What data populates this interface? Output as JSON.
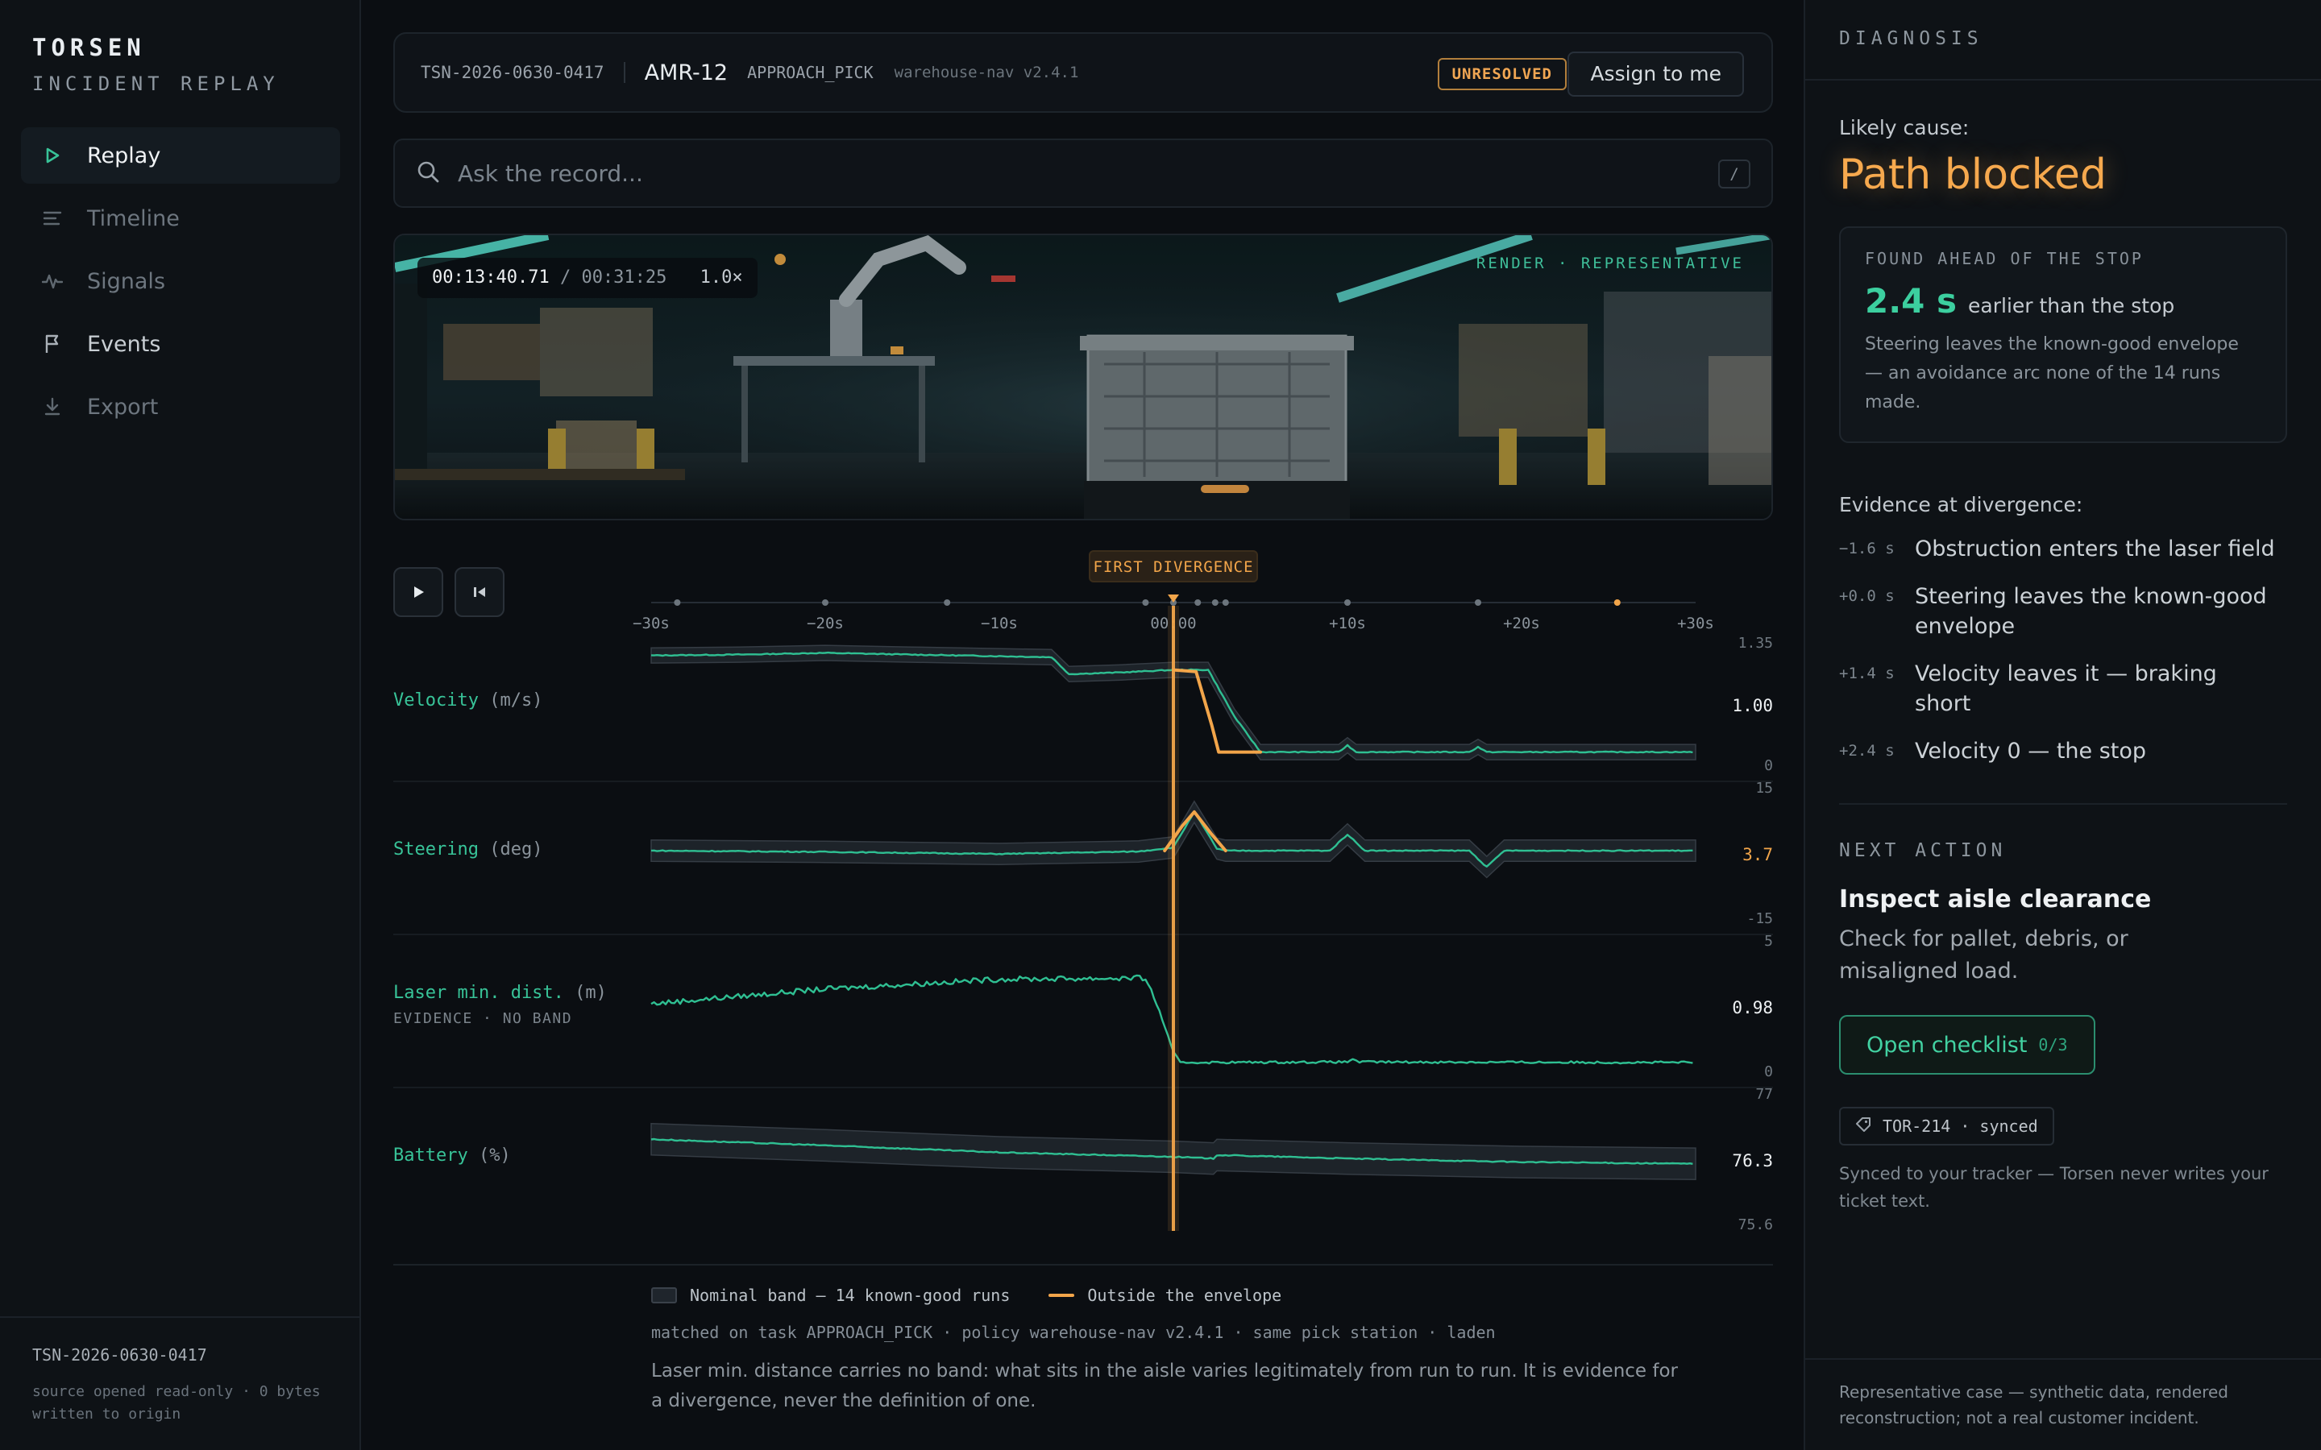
{
  "brand": {
    "name": "TORSEN",
    "subtitle": "INCIDENT REPLAY"
  },
  "nav": [
    {
      "label": "Replay",
      "icon": "play-icon",
      "active": true
    },
    {
      "label": "Timeline",
      "icon": "timeline-icon",
      "active": false
    },
    {
      "label": "Signals",
      "icon": "pulse-icon",
      "active": false
    },
    {
      "label": "Events",
      "icon": "flag-icon",
      "active": false
    },
    {
      "label": "Export",
      "icon": "download-icon",
      "active": false
    }
  ],
  "sidebar_footer": {
    "incident_id": "TSN-2026-0630-0417",
    "note": "source opened read-only · 0 bytes written to origin"
  },
  "header": {
    "incident_id": "TSN-2026-0630-0417",
    "robot": "AMR-12",
    "task": "APPROACH_PICK",
    "version": "warehouse-nav v2.4.1",
    "status": "UNRESOLVED",
    "assign_label": "Assign to me"
  },
  "ask": {
    "placeholder": "Ask the record...",
    "shortcut": "/"
  },
  "video": {
    "current_time": "00:13:40.71",
    "total_time": "/ 00:31:25",
    "speed": "1.0×",
    "tag": "RENDER · REPRESENTATIVE"
  },
  "chart_data": {
    "type": "line",
    "marker_label": "FIRST DIVERGENCE",
    "x_ticks": [
      "−30s",
      "−20s",
      "−10s",
      "00:00",
      "+10s",
      "+20s",
      "+30s"
    ],
    "xlim": [
      -30,
      30
    ],
    "divergence_at": 0,
    "event_marks": [
      -28.5,
      -20,
      -13,
      -1.6,
      0,
      1.4,
      2.4,
      3,
      10,
      17.5,
      25.5
    ],
    "series": [
      {
        "name": "Velocity",
        "unit": "(m/s)",
        "ylim": [
          0,
          1.35
        ],
        "tick_top": "1.35",
        "tick_bottom": "0",
        "current": "1.00",
        "current_color": "#eef1f3",
        "band_halfwidth": 0.09,
        "nominal": [
          [
            -30,
            1.22
          ],
          [
            -25,
            1.23
          ],
          [
            -20,
            1.25
          ],
          [
            -15,
            1.23
          ],
          [
            -7,
            1.2
          ],
          [
            -6,
            1.0
          ],
          [
            -3,
            1.02
          ],
          [
            0,
            1.05
          ],
          [
            2,
            1.05
          ],
          [
            3.5,
            0.5
          ],
          [
            5,
            0.08
          ],
          [
            9.5,
            0.08
          ],
          [
            10,
            0.16
          ],
          [
            10.5,
            0.08
          ],
          [
            17,
            0.08
          ],
          [
            17.5,
            0.14
          ],
          [
            18,
            0.08
          ],
          [
            30,
            0.08
          ]
        ],
        "outside": [
          [
            0,
            1.05
          ],
          [
            1.3,
            1.03
          ],
          [
            2.2,
            0.4
          ],
          [
            2.6,
            0.08
          ],
          [
            5,
            0.08
          ]
        ]
      },
      {
        "name": "Steering",
        "unit": "(deg)",
        "ylim": [
          -15,
          15
        ],
        "tick_top": "15",
        "tick_bottom": "-15",
        "current": "3.7",
        "current_color": "#f2a54a",
        "band_halfwidth": 2.6,
        "nominal": [
          [
            -30,
            0
          ],
          [
            -20,
            -0.3
          ],
          [
            -10,
            -0.8
          ],
          [
            -2,
            -0.2
          ],
          [
            0,
            0.8
          ],
          [
            1.2,
            9.5
          ],
          [
            2.5,
            0.5
          ],
          [
            3,
            0
          ],
          [
            9,
            0
          ],
          [
            10,
            4
          ],
          [
            11,
            0
          ],
          [
            17,
            0
          ],
          [
            18,
            -4
          ],
          [
            19,
            0
          ],
          [
            30,
            0
          ]
        ],
        "outside": [
          [
            -0.5,
            0
          ],
          [
            0.5,
            6
          ],
          [
            1.2,
            9.5
          ],
          [
            2.2,
            4
          ],
          [
            3,
            0
          ]
        ]
      },
      {
        "name": "Laser min. dist.",
        "unit": "(m)",
        "sub": "EVIDENCE · NO BAND",
        "ylim": [
          0,
          5
        ],
        "tick_top": "5",
        "tick_bottom": "0",
        "current": "0.98",
        "current_color": "#eef1f3",
        "band_halfwidth": 0,
        "nominal": [
          [
            -30,
            2.5
          ],
          [
            -20,
            3.1
          ],
          [
            -10,
            3.5
          ],
          [
            -1.6,
            3.55
          ],
          [
            -0.8,
            2.2
          ],
          [
            0,
            0.5
          ],
          [
            0.4,
            0.1
          ],
          [
            10,
            0.12
          ],
          [
            10.3,
            0.25
          ],
          [
            10.7,
            0.12
          ],
          [
            30,
            0.1
          ]
        ],
        "outside": []
      },
      {
        "name": "Battery",
        "unit": "(%)",
        "ylim": [
          75.6,
          77
        ],
        "tick_top": "77",
        "tick_bottom": "75.6",
        "current": "76.3",
        "current_color": "#eef1f3",
        "band_halfwidth": 0.18,
        "nominal": [
          [
            -30,
            76.5
          ],
          [
            -20,
            76.43
          ],
          [
            -10,
            76.35
          ],
          [
            0,
            76.3
          ],
          [
            2.3,
            76.28
          ],
          [
            2.5,
            76.32
          ],
          [
            10,
            76.28
          ],
          [
            20,
            76.24
          ],
          [
            30,
            76.22
          ]
        ],
        "outside": []
      }
    ],
    "legend": {
      "band": "Nominal band — 14 known-good runs",
      "outside": "Outside the envelope"
    }
  },
  "match": "matched on task APPROACH_PICK · policy warehouse-nav v2.4.1 · same pick station · laden",
  "explanation": "Laser min. distance carries no band: what sits in the aisle varies legitimately from run to run. It is evidence for a divergence, never the definition of one.",
  "diagnosis": {
    "heading": "DIAGNOSIS",
    "likely_label": "Likely cause:",
    "likely_cause": "Path blocked",
    "found_label": "FOUND AHEAD OF THE STOP",
    "found_value": "2.4 s",
    "found_suffix": "earlier than the stop",
    "found_desc": "Steering leaves the known-good envelope — an avoidance arc none of the 14 runs made.",
    "evidence_label": "Evidence at divergence:",
    "evidence": [
      {
        "t": "−1.6 s",
        "text": "Obstruction enters the laser field"
      },
      {
        "t": "+0.0 s",
        "text": "Steering leaves the known-good envelope"
      },
      {
        "t": "+1.4 s",
        "text": "Velocity leaves it — braking short"
      },
      {
        "t": "+2.4 s",
        "text": "Velocity 0 — the stop"
      }
    ],
    "next_label": "NEXT ACTION",
    "next_title": "Inspect aisle clearance",
    "next_desc": "Check for pallet, debris, or misaligned load.",
    "checklist_label": "Open checklist",
    "checklist_count": "0/3",
    "ticket": "TOR-214 · synced",
    "ticket_note": "Synced to your tracker — Torsen never writes your ticket text.",
    "footer": "Representative case — synthetic data, rendered reconstruction; not a real customer incident."
  },
  "colors": {
    "accent": "#38c398",
    "warning": "#f2a54a",
    "band": "#1d2329"
  }
}
